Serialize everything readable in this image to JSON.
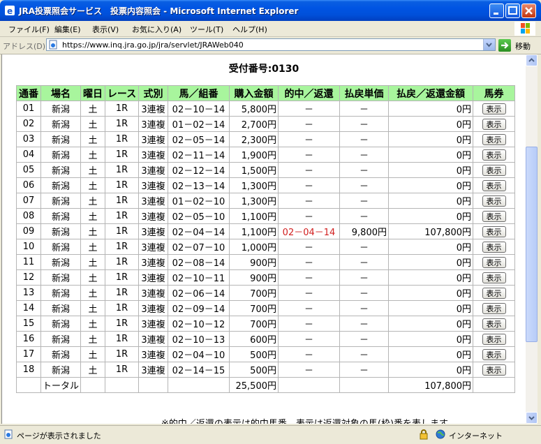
{
  "window": {
    "title": "JRA投票照会サービス　投票内容照会 - Microsoft Internet Explorer"
  },
  "menu": [
    "ファイル(F)",
    "編集(E)",
    "表示(V)",
    "お気に入り(A)",
    "ツール(T)",
    "ヘルプ(H)"
  ],
  "address": {
    "label": "アドレス(D)",
    "url": "https://www.inq.jra.go.jp/jra/servlet/JRAWeb040",
    "go_label": "移動"
  },
  "page": {
    "receipt_label": "受付番号:",
    "receipt_number": "0130",
    "footnote": "※的中／返還の表示は的中馬番、表示は返還対象の馬(枠)番を表します"
  },
  "table": {
    "headers": [
      "通番",
      "場名",
      "曜日",
      "レース",
      "式別",
      "馬／組番",
      "購入金額",
      "的中／返還",
      "払戻単価",
      "払戻／返還金額",
      "馬券"
    ],
    "button_label": "表示",
    "rows": [
      {
        "no": "01",
        "venue": "新潟",
        "day": "土",
        "race": "1R",
        "type": "3連複",
        "combo": "02－10－14",
        "amount": "5,800円",
        "hit": "－",
        "unit": "－",
        "payout": "0円"
      },
      {
        "no": "02",
        "venue": "新潟",
        "day": "土",
        "race": "1R",
        "type": "3連複",
        "combo": "01－02－14",
        "amount": "2,700円",
        "hit": "－",
        "unit": "－",
        "payout": "0円"
      },
      {
        "no": "03",
        "venue": "新潟",
        "day": "土",
        "race": "1R",
        "type": "3連複",
        "combo": "02－05－14",
        "amount": "2,300円",
        "hit": "－",
        "unit": "－",
        "payout": "0円"
      },
      {
        "no": "04",
        "venue": "新潟",
        "day": "土",
        "race": "1R",
        "type": "3連複",
        "combo": "02－11－14",
        "amount": "1,900円",
        "hit": "－",
        "unit": "－",
        "payout": "0円"
      },
      {
        "no": "05",
        "venue": "新潟",
        "day": "土",
        "race": "1R",
        "type": "3連複",
        "combo": "02－12－14",
        "amount": "1,500円",
        "hit": "－",
        "unit": "－",
        "payout": "0円"
      },
      {
        "no": "06",
        "venue": "新潟",
        "day": "土",
        "race": "1R",
        "type": "3連複",
        "combo": "02－13－14",
        "amount": "1,300円",
        "hit": "－",
        "unit": "－",
        "payout": "0円"
      },
      {
        "no": "07",
        "venue": "新潟",
        "day": "土",
        "race": "1R",
        "type": "3連複",
        "combo": "01－02－10",
        "amount": "1,300円",
        "hit": "－",
        "unit": "－",
        "payout": "0円"
      },
      {
        "no": "08",
        "venue": "新潟",
        "day": "土",
        "race": "1R",
        "type": "3連複",
        "combo": "02－05－10",
        "amount": "1,100円",
        "hit": "－",
        "unit": "－",
        "payout": "0円"
      },
      {
        "no": "09",
        "venue": "新潟",
        "day": "土",
        "race": "1R",
        "type": "3連複",
        "combo": "02－04－14",
        "amount": "1,100円",
        "hit": "02－04－14",
        "unit": "9,800円",
        "payout": "107,800円",
        "is_hit": true
      },
      {
        "no": "10",
        "venue": "新潟",
        "day": "土",
        "race": "1R",
        "type": "3連複",
        "combo": "02－07－10",
        "amount": "1,000円",
        "hit": "－",
        "unit": "－",
        "payout": "0円"
      },
      {
        "no": "11",
        "venue": "新潟",
        "day": "土",
        "race": "1R",
        "type": "3連複",
        "combo": "02－08－14",
        "amount": "900円",
        "hit": "－",
        "unit": "－",
        "payout": "0円"
      },
      {
        "no": "12",
        "venue": "新潟",
        "day": "土",
        "race": "1R",
        "type": "3連複",
        "combo": "02－10－11",
        "amount": "900円",
        "hit": "－",
        "unit": "－",
        "payout": "0円"
      },
      {
        "no": "13",
        "venue": "新潟",
        "day": "土",
        "race": "1R",
        "type": "3連複",
        "combo": "02－06－14",
        "amount": "700円",
        "hit": "－",
        "unit": "－",
        "payout": "0円"
      },
      {
        "no": "14",
        "venue": "新潟",
        "day": "土",
        "race": "1R",
        "type": "3連複",
        "combo": "02－09－14",
        "amount": "700円",
        "hit": "－",
        "unit": "－",
        "payout": "0円"
      },
      {
        "no": "15",
        "venue": "新潟",
        "day": "土",
        "race": "1R",
        "type": "3連複",
        "combo": "02－10－12",
        "amount": "700円",
        "hit": "－",
        "unit": "－",
        "payout": "0円"
      },
      {
        "no": "16",
        "venue": "新潟",
        "day": "土",
        "race": "1R",
        "type": "3連複",
        "combo": "02－10－13",
        "amount": "600円",
        "hit": "－",
        "unit": "－",
        "payout": "0円"
      },
      {
        "no": "17",
        "venue": "新潟",
        "day": "土",
        "race": "1R",
        "type": "3連複",
        "combo": "02－04－10",
        "amount": "500円",
        "hit": "－",
        "unit": "－",
        "payout": "0円"
      },
      {
        "no": "18",
        "venue": "新潟",
        "day": "土",
        "race": "1R",
        "type": "3連複",
        "combo": "02－14－15",
        "amount": "500円",
        "hit": "－",
        "unit": "－",
        "payout": "0円"
      }
    ],
    "total": {
      "label": "トータル",
      "amount": "25,500円",
      "payout": "107,800円"
    }
  },
  "status": {
    "text": "ページが表示されました",
    "zone": "インターネット"
  },
  "colors": {
    "header_bg": "#A8F59D",
    "hit_text": "#D22020",
    "titlebar": "#0054E3"
  }
}
